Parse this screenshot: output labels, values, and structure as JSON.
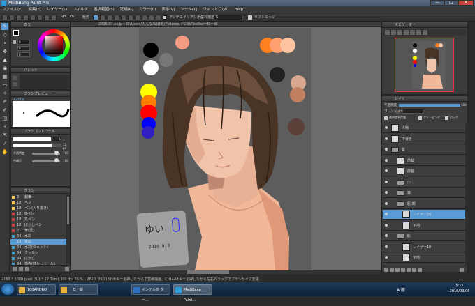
{
  "app": {
    "title": "MediBang Paint Pro",
    "min": "—",
    "max": "□",
    "close": "✕"
  },
  "menu": [
    "ファイル(F)",
    "編集(E)",
    "レイヤー(L)",
    "フィルタ",
    "選択範囲(S)",
    "定規(R)",
    "カラー(C)",
    "表示(V)",
    "ツール(T)",
    "ウィンドウ(W)",
    "Help"
  ],
  "toolbar": {
    "antialias_label": "アンチエイリアシング",
    "correction_label": "手ぶれ補正",
    "correction_value": "5",
    "soft_edge_label": "ソフトエッジ",
    "mode_label": "矩形"
  },
  "canvas_tab": "2016.07.xx.jp - D:/Users/みんな/図書館/Pictures/デジ絵/TeeNe/一日一絵",
  "color_panel": {
    "title": "カラー",
    "h": "0",
    "s": "0",
    "v": "0"
  },
  "palette_panel": {
    "title": "パレット"
  },
  "brush_preview": {
    "title": "ブラシプレビュー",
    "label": "そのまま"
  },
  "brush_control": {
    "title": "ブラシコントロール",
    "size_value": "1",
    "size_unit": "15 px",
    "opacity_label": "不透明度",
    "opacity_value": "100",
    "smooth_label": "色補正",
    "smooth_value": "100"
  },
  "brush_list": {
    "title": "ブラシ",
    "items": [
      {
        "size": "3",
        "name": "鉛筆",
        "color": "#f0c040"
      },
      {
        "size": "18",
        "name": "ペン",
        "color": "#f0c040"
      },
      {
        "size": "18",
        "name": "ペン(入り抜き)",
        "color": "#f0c040"
      },
      {
        "size": "18",
        "name": "Gペン",
        "color": "#d04040"
      },
      {
        "size": "18",
        "name": "丸ペン",
        "color": "#d04040"
      },
      {
        "size": "18",
        "name": "ぼかしペン",
        "color": "#d04040"
      },
      {
        "size": "21",
        "name": "筆(濃)",
        "color": "#d04040"
      },
      {
        "size": "64",
        "name": "水彩",
        "color": "#40a0d0"
      },
      {
        "size": "19",
        "name": "水彩",
        "color": "#40a0d0"
      },
      {
        "size": "64",
        "name": "水彩(ウェット)",
        "color": "#40a0d0"
      },
      {
        "size": "64",
        "name": "クレヨン",
        "color": "#40a0d0"
      },
      {
        "size": "64",
        "name": "ぼかし",
        "color": "#40a0d0"
      },
      {
        "size": "64",
        "name": "指先(ぼかしツール)",
        "color": "#40a0d0"
      }
    ],
    "selected_index": 8
  },
  "navigator": {
    "title": "ナビゲーター"
  },
  "layer_panel": {
    "title": "レイヤー",
    "opacity_label": "不透明度",
    "opacity_value": "100",
    "blend_label": "ブレンド",
    "blend_value": "通常",
    "protect_alpha": "透明度を保護",
    "clipping": "クリッピング",
    "lock": "ロック",
    "layers": [
      {
        "name": "人物",
        "indent": 0,
        "folder": false
      },
      {
        "name": "下書き",
        "indent": 0,
        "folder": false
      },
      {
        "name": "髪",
        "indent": 0,
        "folder": true
      },
      {
        "name": "前髪",
        "indent": 1,
        "folder": false
      },
      {
        "name": "前髪",
        "indent": 1,
        "folder": false
      },
      {
        "name": "ロ",
        "indent": 1,
        "folder": true
      },
      {
        "name": "目",
        "indent": 1,
        "folder": true
      },
      {
        "name": "肌 顔",
        "indent": 1,
        "folder": true
      },
      {
        "name": "レイヤー26",
        "indent": 2,
        "folder": false
      },
      {
        "name": "下地",
        "indent": 2,
        "folder": false
      },
      {
        "name": "肌",
        "indent": 1,
        "folder": true
      },
      {
        "name": "レイヤー19",
        "indent": 2,
        "folder": false
      },
      {
        "name": "下地",
        "indent": 2,
        "folder": false
      }
    ],
    "selected_index": 8
  },
  "status": "2160 * 3000 pixel   (9.1 * 12.7cm)   300 dpi   28 %   ( 2610, 390 )   Shiftキーを押しながらで直線描画、Ctrl+Altキーを押しながら左右ドラッグでブラシサイズ変更",
  "taskbar": {
    "items": [
      {
        "label": "100ANDRO",
        "color": "#e8b040"
      },
      {
        "label": "一日一絵",
        "color": "#e8b040"
      },
      {
        "label": "インテル® ター...",
        "color": "#3070c0"
      },
      {
        "label": "MediBang Paint...",
        "color": "#2a9ad8"
      }
    ],
    "time": "5:15",
    "date": "2018/09/06",
    "ime": "A 般"
  },
  "signature": {
    "text": "ゆい",
    "date": "2018. 9. 3"
  },
  "swatches": [
    "#000000",
    "#ffffff",
    "#ffff00",
    "#ff8000",
    "#ff0000",
    "#0000ff",
    "#f49a80",
    "#ff8a20",
    "#ffa070",
    "#fcc4a0",
    "#222222",
    "#d8a890",
    "#c08060",
    "#5a4038",
    "#777777",
    "#999999"
  ]
}
